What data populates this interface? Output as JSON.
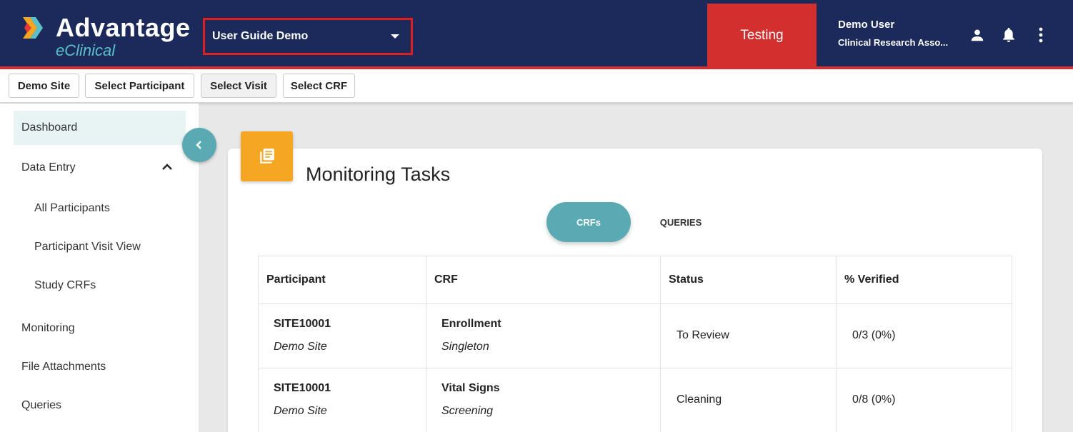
{
  "header": {
    "logo_title": "Advantage",
    "logo_subtitle": "eClinical",
    "study_select": "User Guide Demo",
    "environment": "Testing",
    "user_name": "Demo User",
    "user_role": "Clinical Research Asso..."
  },
  "toolbar": {
    "site": "Demo Site",
    "participant": "Select Participant",
    "visit": "Select Visit",
    "crf": "Select CRF"
  },
  "sidebar": {
    "items": [
      {
        "label": "Dashboard"
      },
      {
        "label": "Data Entry"
      },
      {
        "label": "All Participants"
      },
      {
        "label": "Participant Visit View"
      },
      {
        "label": "Study CRFs"
      },
      {
        "label": "Monitoring"
      },
      {
        "label": "File Attachments"
      },
      {
        "label": "Queries"
      }
    ]
  },
  "main": {
    "title": "Monitoring Tasks",
    "tabs": [
      "CRFs",
      "QUERIES"
    ],
    "columns": [
      "Participant",
      "CRF",
      "Status",
      "% Verified"
    ],
    "rows": [
      {
        "participant": "SITE10001",
        "site": "Demo Site",
        "crf": "Enrollment",
        "visit": "Singleton",
        "status": "To Review",
        "verified": "0/3 (0%)"
      },
      {
        "participant": "SITE10001",
        "site": "Demo Site",
        "crf": "Vital Signs",
        "visit": "Screening",
        "status": "Cleaning",
        "verified": "0/8 (0%)"
      }
    ]
  },
  "colors": {
    "header_bg": "#1b2a5a",
    "accent_red": "#d32f2f",
    "teal": "#5aaab4",
    "orange": "#f5a623"
  }
}
